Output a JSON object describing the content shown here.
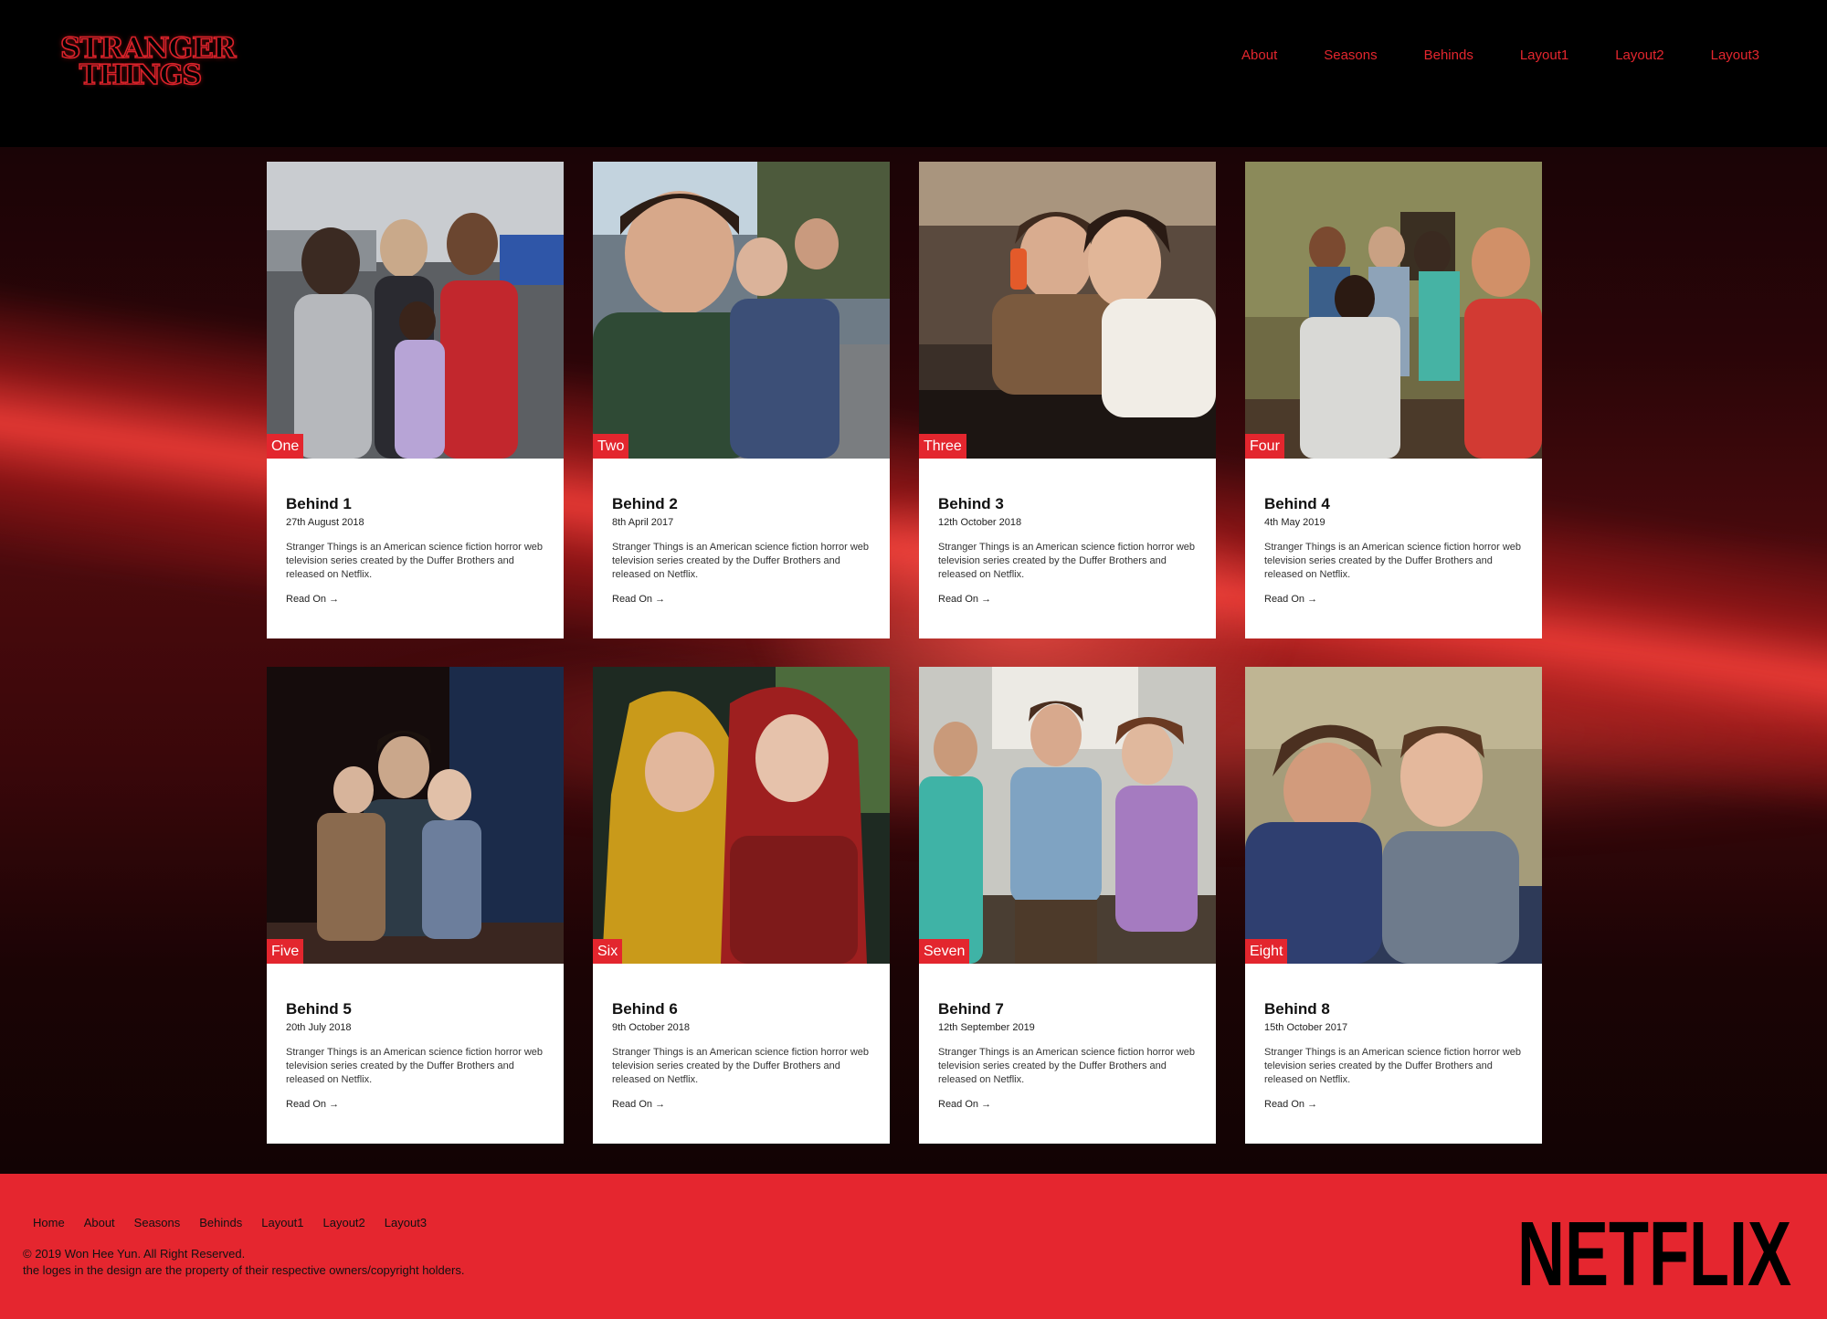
{
  "header": {
    "logo_line1": "STRANGER",
    "logo_line2": "THINGS",
    "nav": [
      "About",
      "Seasons",
      "Behinds",
      "Layout1",
      "Layout2",
      "Layout3"
    ]
  },
  "colors": {
    "accent": "#e3262e",
    "header_bg": "#000000",
    "footer_bg": "#e5262f"
  },
  "cards": [
    {
      "num": "One",
      "title": "Behind 1",
      "date": "27th August 2018",
      "desc": "Stranger Things is an American science fiction horror web television series created by the Duffer Brothers and released on Netflix.",
      "more": "Read On →"
    },
    {
      "num": "Two",
      "title": "Behind 2",
      "date": "8th April 2017",
      "desc": "Stranger Things is an American science fiction horror web television series created by the Duffer Brothers and released on Netflix.",
      "more": "Read On →"
    },
    {
      "num": "Three",
      "title": "Behind 3",
      "date": "12th October 2018",
      "desc": "Stranger Things is an American science fiction horror web television series created by the Duffer Brothers and released on Netflix.",
      "more": "Read On →"
    },
    {
      "num": "Four",
      "title": "Behind 4",
      "date": "4th May 2019",
      "desc": "Stranger Things is an American science fiction horror web television series created by the Duffer Brothers and released on Netflix.",
      "more": "Read On →"
    },
    {
      "num": "Five",
      "title": "Behind 5",
      "date": "20th July 2018",
      "desc": "Stranger Things is an American science fiction horror web television series created by the Duffer Brothers and released on Netflix.",
      "more": "Read On →"
    },
    {
      "num": "Six",
      "title": "Behind 6",
      "date": "9th October 2018",
      "desc": "Stranger Things is an American science fiction horror web television series created by the Duffer Brothers and released on Netflix.",
      "more": "Read On →"
    },
    {
      "num": "Seven",
      "title": "Behind 7",
      "date": "12th September 2019",
      "desc": "Stranger Things is an American science fiction horror web television series created by the Duffer Brothers and released on Netflix.",
      "more": "Read On →"
    },
    {
      "num": "Eight",
      "title": "Behind 8",
      "date": "15th October 2017",
      "desc": "Stranger Things is an American science fiction horror web television series created by the Duffer Brothers and released on Netflix.",
      "more": "Read On →"
    }
  ],
  "footer": {
    "nav": [
      "Home",
      "About",
      "Seasons",
      "Behinds",
      "Layout1",
      "Layout2",
      "Layout3"
    ],
    "copyright": "© 2019 Won Hee Yun. All Right Reserved.",
    "notice": "the loges in the design are the property of their respective owners/copyright holders.",
    "brand": "NETFLIX"
  }
}
